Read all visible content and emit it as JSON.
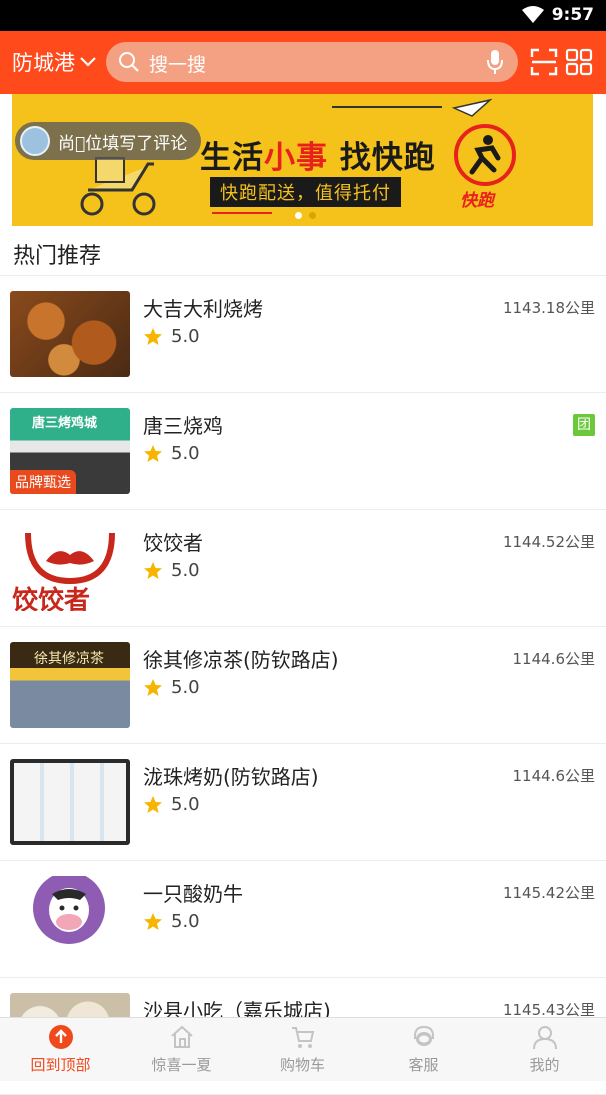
{
  "status_bar": {
    "time": "9:57"
  },
  "header": {
    "city": "防城港",
    "search_placeholder": "搜一搜"
  },
  "banner": {
    "notice": "尚\u0000位填写了评论",
    "headline_a": "生活",
    "headline_b": "小事",
    "headline_c": " 找快跑",
    "subline": "快跑配送，值得托付",
    "logo_text": "快跑",
    "dots": 2,
    "active_dot": 0
  },
  "section": {
    "title": "热门推荐"
  },
  "shops": [
    {
      "name": "大吉大利烧烤",
      "rating": "5.0",
      "distance": "1143.18公里"
    },
    {
      "name": "唐三烧鸡",
      "rating": "5.0",
      "distance": "",
      "tag": "团",
      "badge": "品牌甄选"
    },
    {
      "name": "饺饺者",
      "rating": "5.0",
      "distance": "1144.52公里"
    },
    {
      "name": "徐其修凉茶(防钦路店)",
      "rating": "5.0",
      "distance": "1144.6公里"
    },
    {
      "name": "泷珠烤奶(防钦路店)",
      "rating": "5.0",
      "distance": "1144.6公里"
    },
    {
      "name": "一只酸奶牛",
      "rating": "5.0",
      "distance": "1145.42公里"
    },
    {
      "name": "沙县小吃（嘉乐城店)",
      "rating": "",
      "distance": "1145.43公里"
    }
  ],
  "bottom_nav": [
    {
      "label": "回到顶部",
      "icon": "arrow-up-circle-icon",
      "active": true
    },
    {
      "label": "惊喜一夏",
      "icon": "home-icon"
    },
    {
      "label": "购物车",
      "icon": "cart-icon"
    },
    {
      "label": "客服",
      "icon": "headset-icon"
    },
    {
      "label": "我的",
      "icon": "user-icon"
    }
  ],
  "colors": {
    "brand": "#ff4a1c",
    "banner_bg": "#f5c21b",
    "star": "#f7b500",
    "tuan_tag": "#6ac83a"
  }
}
